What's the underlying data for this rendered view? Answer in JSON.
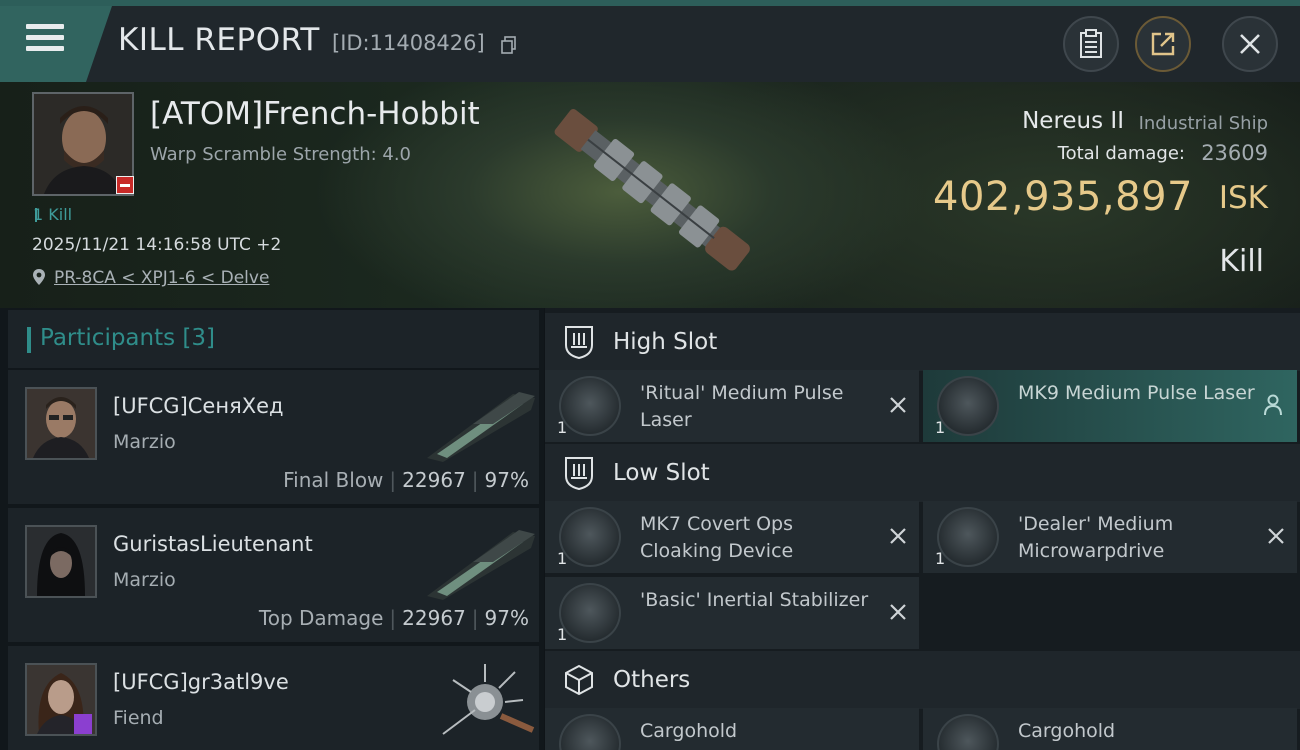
{
  "header": {
    "title": "KILL REPORT",
    "report_id": "[ID:11408426]"
  },
  "victim": {
    "name": "[ATOM]French-Hobbit",
    "warp_scramble": "Warp Scramble Strength: 4.0",
    "kills": "1 Kill",
    "datetime": "2025/11/21 14:16:58 UTC +2",
    "location": "PR-8CA < XPJ1-6 < Delve",
    "ship_name": "Nereus II",
    "ship_class": "Industrial Ship",
    "total_damage_label": "Total damage:",
    "total_damage": "23609",
    "isk_value": "402,935,897",
    "isk_unit": "ISK",
    "result": "Kill"
  },
  "participants": {
    "title": "Participants",
    "count": "[3]",
    "rows": [
      {
        "name": "[UFCG]СеняХед",
        "ship": "Marzio",
        "role": "Final Blow",
        "damage": "22967",
        "percent": "97%"
      },
      {
        "name": "GuristasLieutenant",
        "ship": "Marzio",
        "role": "Top Damage",
        "damage": "22967",
        "percent": "97%"
      },
      {
        "name": "[UFCG]gr3atl9ve",
        "ship": "Fiend"
      }
    ]
  },
  "slots": {
    "high": {
      "title": "High Slot",
      "items": [
        {
          "qty": "1",
          "name": "'Ritual' Medium Pulse Laser"
        },
        {
          "qty": "1",
          "name": "MK9 Medium Pulse Laser"
        }
      ]
    },
    "low": {
      "title": "Low Slot",
      "items": [
        {
          "qty": "1",
          "name": "MK7 Covert Ops Cloaking Device"
        },
        {
          "qty": "1",
          "name": "'Dealer' Medium Microwarpdrive"
        },
        {
          "qty": "1",
          "name": "'Basic' Inertial Stabilizer"
        }
      ]
    },
    "others": {
      "title": "Others",
      "items": [
        {
          "name": "Cargohold"
        },
        {
          "name": "Cargohold"
        }
      ]
    }
  },
  "colors": {
    "accent_teal": "#2f8d8a",
    "isk_gold": "#e6c98a",
    "victim_badge": "#c82a28"
  }
}
